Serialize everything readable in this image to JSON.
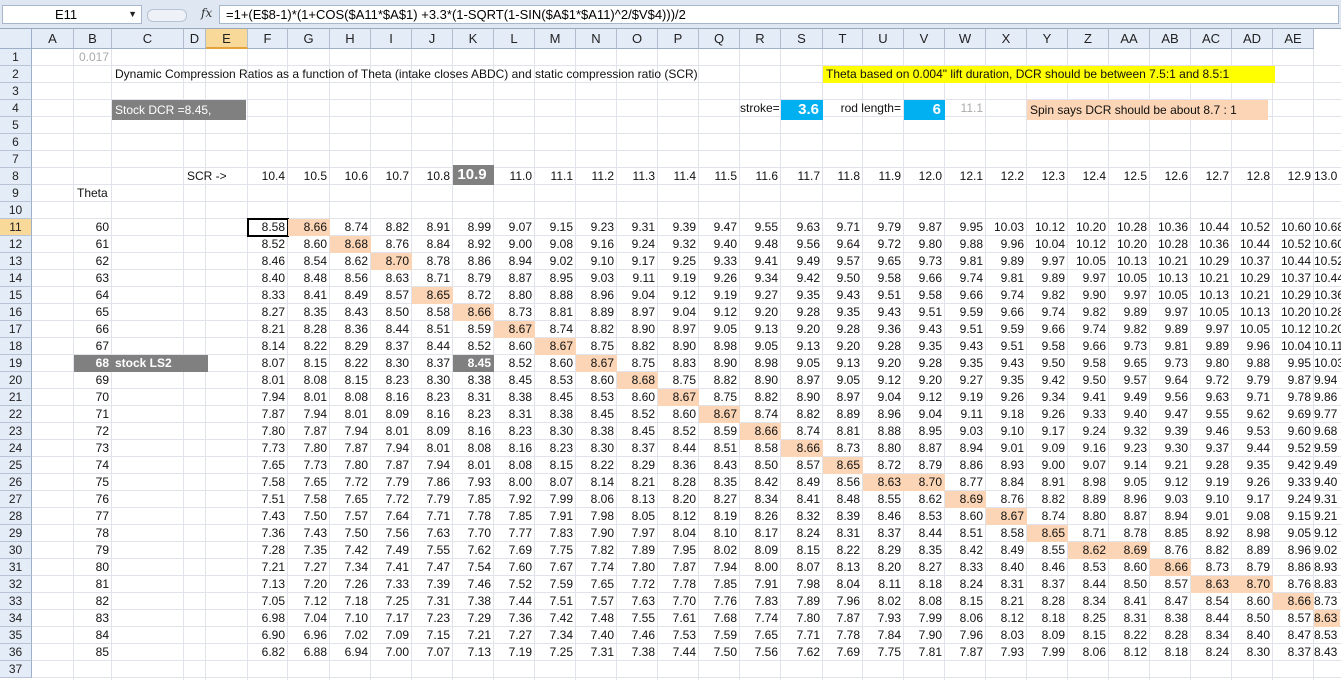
{
  "formula_bar": {
    "name_box": "E11",
    "fx": "fx",
    "formula": "=1+(E$8-1)*(1+COS($A11*$A$1) +3.3*(1-SQRT(1-SIN($A$1*$A11)^2/$V$4)))/2"
  },
  "columns": [
    "A",
    "B",
    "C",
    "D",
    "E",
    "F",
    "G",
    "H",
    "I",
    "J",
    "K",
    "L",
    "M",
    "N",
    "O",
    "P",
    "Q",
    "R",
    "S",
    "T",
    "U",
    "V",
    "W",
    "X",
    "Y",
    "Z",
    "AA",
    "AB",
    "AC",
    "AD",
    "AE"
  ],
  "sheet": {
    "a1": "0.017",
    "title": "Dynamic Compression Ratios as a function of Theta (intake closes ABDC) and static compression ratio (SCR)",
    "theta_note": "Theta based on 0.004\" lift duration, DCR should be between 7.5:1 and 8.5:1",
    "stock_dcr": "Stock DCR =8.45,",
    "stroke_label": "stroke=",
    "stroke_value": "3.6",
    "rod_label": "rod length=",
    "rod_value": "6",
    "ratio_value": "11.1",
    "spin_note": "Spin says DCR should be about 8.7 : 1",
    "scr_label": "SCR ->",
    "theta_label": "Theta",
    "stock_ls2": "stock LS2",
    "scr": [
      "10.4",
      "10.5",
      "10.6",
      "10.7",
      "10.8",
      "10.9",
      "11.0",
      "11.1",
      "11.2",
      "11.3",
      "11.4",
      "11.5",
      "11.6",
      "11.7",
      "11.8",
      "11.9",
      "12.0",
      "12.1",
      "12.2",
      "12.3",
      "12.4",
      "12.5",
      "12.6",
      "12.7",
      "12.8",
      "12.9",
      "13.0"
    ],
    "rows": [
      {
        "theta": "60",
        "values": [
          "8.58",
          "8.66",
          "8.74",
          "8.82",
          "8.91",
          "8.99",
          "9.07",
          "9.15",
          "9.23",
          "9.31",
          "9.39",
          "9.47",
          "9.55",
          "9.63",
          "9.71",
          "9.79",
          "9.87",
          "9.95",
          "10.03",
          "10.12",
          "10.20",
          "10.28",
          "10.36",
          "10.44",
          "10.52",
          "10.60",
          "10.68"
        ]
      },
      {
        "theta": "61",
        "values": [
          "8.52",
          "8.60",
          "8.68",
          "8.76",
          "8.84",
          "8.92",
          "9.00",
          "9.08",
          "9.16",
          "9.24",
          "9.32",
          "9.40",
          "9.48",
          "9.56",
          "9.64",
          "9.72",
          "9.80",
          "9.88",
          "9.96",
          "10.04",
          "10.12",
          "10.20",
          "10.28",
          "10.36",
          "10.44",
          "10.52",
          "10.60"
        ]
      },
      {
        "theta": "62",
        "values": [
          "8.46",
          "8.54",
          "8.62",
          "8.70",
          "8.78",
          "8.86",
          "8.94",
          "9.02",
          "9.10",
          "9.17",
          "9.25",
          "9.33",
          "9.41",
          "9.49",
          "9.57",
          "9.65",
          "9.73",
          "9.81",
          "9.89",
          "9.97",
          "10.05",
          "10.13",
          "10.21",
          "10.29",
          "10.37",
          "10.44",
          "10.52"
        ]
      },
      {
        "theta": "63",
        "values": [
          "8.40",
          "8.48",
          "8.56",
          "8.63",
          "8.71",
          "8.79",
          "8.87",
          "8.95",
          "9.03",
          "9.11",
          "9.19",
          "9.26",
          "9.34",
          "9.42",
          "9.50",
          "9.58",
          "9.66",
          "9.74",
          "9.81",
          "9.89",
          "9.97",
          "10.05",
          "10.13",
          "10.21",
          "10.29",
          "10.37",
          "10.44"
        ]
      },
      {
        "theta": "64",
        "values": [
          "8.33",
          "8.41",
          "8.49",
          "8.57",
          "8.65",
          "8.72",
          "8.80",
          "8.88",
          "8.96",
          "9.04",
          "9.12",
          "9.19",
          "9.27",
          "9.35",
          "9.43",
          "9.51",
          "9.58",
          "9.66",
          "9.74",
          "9.82",
          "9.90",
          "9.97",
          "10.05",
          "10.13",
          "10.21",
          "10.29",
          "10.36"
        ]
      },
      {
        "theta": "65",
        "values": [
          "8.27",
          "8.35",
          "8.43",
          "8.50",
          "8.58",
          "8.66",
          "8.73",
          "8.81",
          "8.89",
          "8.97",
          "9.04",
          "9.12",
          "9.20",
          "9.28",
          "9.35",
          "9.43",
          "9.51",
          "9.59",
          "9.66",
          "9.74",
          "9.82",
          "9.89",
          "9.97",
          "10.05",
          "10.13",
          "10.20",
          "10.28"
        ]
      },
      {
        "theta": "66",
        "values": [
          "8.21",
          "8.28",
          "8.36",
          "8.44",
          "8.51",
          "8.59",
          "8.67",
          "8.74",
          "8.82",
          "8.90",
          "8.97",
          "9.05",
          "9.13",
          "9.20",
          "9.28",
          "9.36",
          "9.43",
          "9.51",
          "9.59",
          "9.66",
          "9.74",
          "9.82",
          "9.89",
          "9.97",
          "10.05",
          "10.12",
          "10.20"
        ]
      },
      {
        "theta": "67",
        "values": [
          "8.14",
          "8.22",
          "8.29",
          "8.37",
          "8.44",
          "8.52",
          "8.60",
          "8.67",
          "8.75",
          "8.82",
          "8.90",
          "8.98",
          "9.05",
          "9.13",
          "9.20",
          "9.28",
          "9.35",
          "9.43",
          "9.51",
          "9.58",
          "9.66",
          "9.73",
          "9.81",
          "9.89",
          "9.96",
          "10.04",
          "10.11"
        ]
      },
      {
        "theta": "68",
        "values": [
          "8.07",
          "8.15",
          "8.22",
          "8.30",
          "8.37",
          "8.45",
          "8.52",
          "8.60",
          "8.67",
          "8.75",
          "8.83",
          "8.90",
          "8.98",
          "9.05",
          "9.13",
          "9.20",
          "9.28",
          "9.35",
          "9.43",
          "9.50",
          "9.58",
          "9.65",
          "9.73",
          "9.80",
          "9.88",
          "9.95",
          "10.03"
        ]
      },
      {
        "theta": "69",
        "values": [
          "8.01",
          "8.08",
          "8.15",
          "8.23",
          "8.30",
          "8.38",
          "8.45",
          "8.53",
          "8.60",
          "8.68",
          "8.75",
          "8.82",
          "8.90",
          "8.97",
          "9.05",
          "9.12",
          "9.20",
          "9.27",
          "9.35",
          "9.42",
          "9.50",
          "9.57",
          "9.64",
          "9.72",
          "9.79",
          "9.87",
          "9.94"
        ]
      },
      {
        "theta": "70",
        "values": [
          "7.94",
          "8.01",
          "8.08",
          "8.16",
          "8.23",
          "8.31",
          "8.38",
          "8.45",
          "8.53",
          "8.60",
          "8.67",
          "8.75",
          "8.82",
          "8.90",
          "8.97",
          "9.04",
          "9.12",
          "9.19",
          "9.26",
          "9.34",
          "9.41",
          "9.49",
          "9.56",
          "9.63",
          "9.71",
          "9.78",
          "9.86"
        ]
      },
      {
        "theta": "71",
        "values": [
          "7.87",
          "7.94",
          "8.01",
          "8.09",
          "8.16",
          "8.23",
          "8.31",
          "8.38",
          "8.45",
          "8.52",
          "8.60",
          "8.67",
          "8.74",
          "8.82",
          "8.89",
          "8.96",
          "9.04",
          "9.11",
          "9.18",
          "9.26",
          "9.33",
          "9.40",
          "9.47",
          "9.55",
          "9.62",
          "9.69",
          "9.77"
        ]
      },
      {
        "theta": "72",
        "values": [
          "7.80",
          "7.87",
          "7.94",
          "8.01",
          "8.09",
          "8.16",
          "8.23",
          "8.30",
          "8.38",
          "8.45",
          "8.52",
          "8.59",
          "8.66",
          "8.74",
          "8.81",
          "8.88",
          "8.95",
          "9.03",
          "9.10",
          "9.17",
          "9.24",
          "9.32",
          "9.39",
          "9.46",
          "9.53",
          "9.60",
          "9.68"
        ]
      },
      {
        "theta": "73",
        "values": [
          "7.73",
          "7.80",
          "7.87",
          "7.94",
          "8.01",
          "8.08",
          "8.16",
          "8.23",
          "8.30",
          "8.37",
          "8.44",
          "8.51",
          "8.58",
          "8.66",
          "8.73",
          "8.80",
          "8.87",
          "8.94",
          "9.01",
          "9.09",
          "9.16",
          "9.23",
          "9.30",
          "9.37",
          "9.44",
          "9.52",
          "9.59"
        ]
      },
      {
        "theta": "74",
        "values": [
          "7.65",
          "7.73",
          "7.80",
          "7.87",
          "7.94",
          "8.01",
          "8.08",
          "8.15",
          "8.22",
          "8.29",
          "8.36",
          "8.43",
          "8.50",
          "8.57",
          "8.65",
          "8.72",
          "8.79",
          "8.86",
          "8.93",
          "9.00",
          "9.07",
          "9.14",
          "9.21",
          "9.28",
          "9.35",
          "9.42",
          "9.49"
        ]
      },
      {
        "theta": "75",
        "values": [
          "7.58",
          "7.65",
          "7.72",
          "7.79",
          "7.86",
          "7.93",
          "8.00",
          "8.07",
          "8.14",
          "8.21",
          "8.28",
          "8.35",
          "8.42",
          "8.49",
          "8.56",
          "8.63",
          "8.70",
          "8.77",
          "8.84",
          "8.91",
          "8.98",
          "9.05",
          "9.12",
          "9.19",
          "9.26",
          "9.33",
          "9.40"
        ]
      },
      {
        "theta": "76",
        "values": [
          "7.51",
          "7.58",
          "7.65",
          "7.72",
          "7.79",
          "7.85",
          "7.92",
          "7.99",
          "8.06",
          "8.13",
          "8.20",
          "8.27",
          "8.34",
          "8.41",
          "8.48",
          "8.55",
          "8.62",
          "8.69",
          "8.76",
          "8.82",
          "8.89",
          "8.96",
          "9.03",
          "9.10",
          "9.17",
          "9.24",
          "9.31"
        ]
      },
      {
        "theta": "77",
        "values": [
          "7.43",
          "7.50",
          "7.57",
          "7.64",
          "7.71",
          "7.78",
          "7.85",
          "7.91",
          "7.98",
          "8.05",
          "8.12",
          "8.19",
          "8.26",
          "8.32",
          "8.39",
          "8.46",
          "8.53",
          "8.60",
          "8.67",
          "8.74",
          "8.80",
          "8.87",
          "8.94",
          "9.01",
          "9.08",
          "9.15",
          "9.21"
        ]
      },
      {
        "theta": "78",
        "values": [
          "7.36",
          "7.43",
          "7.50",
          "7.56",
          "7.63",
          "7.70",
          "7.77",
          "7.83",
          "7.90",
          "7.97",
          "8.04",
          "8.10",
          "8.17",
          "8.24",
          "8.31",
          "8.37",
          "8.44",
          "8.51",
          "8.58",
          "8.65",
          "8.71",
          "8.78",
          "8.85",
          "8.92",
          "8.98",
          "9.05",
          "9.12"
        ]
      },
      {
        "theta": "79",
        "values": [
          "7.28",
          "7.35",
          "7.42",
          "7.49",
          "7.55",
          "7.62",
          "7.69",
          "7.75",
          "7.82",
          "7.89",
          "7.95",
          "8.02",
          "8.09",
          "8.15",
          "8.22",
          "8.29",
          "8.35",
          "8.42",
          "8.49",
          "8.55",
          "8.62",
          "8.69",
          "8.76",
          "8.82",
          "8.89",
          "8.96",
          "9.02"
        ]
      },
      {
        "theta": "80",
        "values": [
          "7.21",
          "7.27",
          "7.34",
          "7.41",
          "7.47",
          "7.54",
          "7.60",
          "7.67",
          "7.74",
          "7.80",
          "7.87",
          "7.94",
          "8.00",
          "8.07",
          "8.13",
          "8.20",
          "8.27",
          "8.33",
          "8.40",
          "8.46",
          "8.53",
          "8.60",
          "8.66",
          "8.73",
          "8.79",
          "8.86",
          "8.93"
        ]
      },
      {
        "theta": "81",
        "values": [
          "7.13",
          "7.20",
          "7.26",
          "7.33",
          "7.39",
          "7.46",
          "7.52",
          "7.59",
          "7.65",
          "7.72",
          "7.78",
          "7.85",
          "7.91",
          "7.98",
          "8.04",
          "8.11",
          "8.18",
          "8.24",
          "8.31",
          "8.37",
          "8.44",
          "8.50",
          "8.57",
          "8.63",
          "8.70",
          "8.76",
          "8.83"
        ]
      },
      {
        "theta": "82",
        "values": [
          "7.05",
          "7.12",
          "7.18",
          "7.25",
          "7.31",
          "7.38",
          "7.44",
          "7.51",
          "7.57",
          "7.63",
          "7.70",
          "7.76",
          "7.83",
          "7.89",
          "7.96",
          "8.02",
          "8.08",
          "8.15",
          "8.21",
          "8.28",
          "8.34",
          "8.41",
          "8.47",
          "8.54",
          "8.60",
          "8.66",
          "8.73"
        ]
      },
      {
        "theta": "83",
        "values": [
          "6.98",
          "7.04",
          "7.10",
          "7.17",
          "7.23",
          "7.29",
          "7.36",
          "7.42",
          "7.48",
          "7.55",
          "7.61",
          "7.68",
          "7.74",
          "7.80",
          "7.87",
          "7.93",
          "7.99",
          "8.06",
          "8.12",
          "8.18",
          "8.25",
          "8.31",
          "8.38",
          "8.44",
          "8.50",
          "8.57",
          "8.63"
        ]
      },
      {
        "theta": "84",
        "values": [
          "6.90",
          "6.96",
          "7.02",
          "7.09",
          "7.15",
          "7.21",
          "7.27",
          "7.34",
          "7.40",
          "7.46",
          "7.53",
          "7.59",
          "7.65",
          "7.71",
          "7.78",
          "7.84",
          "7.90",
          "7.96",
          "8.03",
          "8.09",
          "8.15",
          "8.22",
          "8.28",
          "8.34",
          "8.40",
          "8.47",
          "8.53"
        ]
      },
      {
        "theta": "85",
        "values": [
          "6.82",
          "6.88",
          "6.94",
          "7.00",
          "7.07",
          "7.13",
          "7.19",
          "7.25",
          "7.31",
          "7.38",
          "7.44",
          "7.50",
          "7.56",
          "7.62",
          "7.69",
          "7.75",
          "7.81",
          "7.87",
          "7.93",
          "7.99",
          "8.06",
          "8.12",
          "8.18",
          "8.24",
          "8.30",
          "8.37",
          "8.43"
        ]
      }
    ],
    "highlights": [
      [
        0,
        1
      ],
      [
        1,
        2
      ],
      [
        2,
        3
      ],
      [
        4,
        4
      ],
      [
        5,
        5
      ],
      [
        6,
        6
      ],
      [
        7,
        7
      ],
      [
        8,
        8
      ],
      [
        9,
        9
      ],
      [
        10,
        10
      ],
      [
        11,
        11
      ],
      [
        12,
        12
      ],
      [
        13,
        13
      ],
      [
        14,
        14
      ],
      [
        15,
        15
      ],
      [
        15,
        16
      ],
      [
        16,
        17
      ],
      [
        17,
        18
      ],
      [
        18,
        19
      ],
      [
        19,
        20
      ],
      [
        19,
        21
      ],
      [
        20,
        22
      ],
      [
        21,
        23
      ],
      [
        21,
        24
      ],
      [
        22,
        25
      ],
      [
        23,
        26
      ]
    ]
  }
}
